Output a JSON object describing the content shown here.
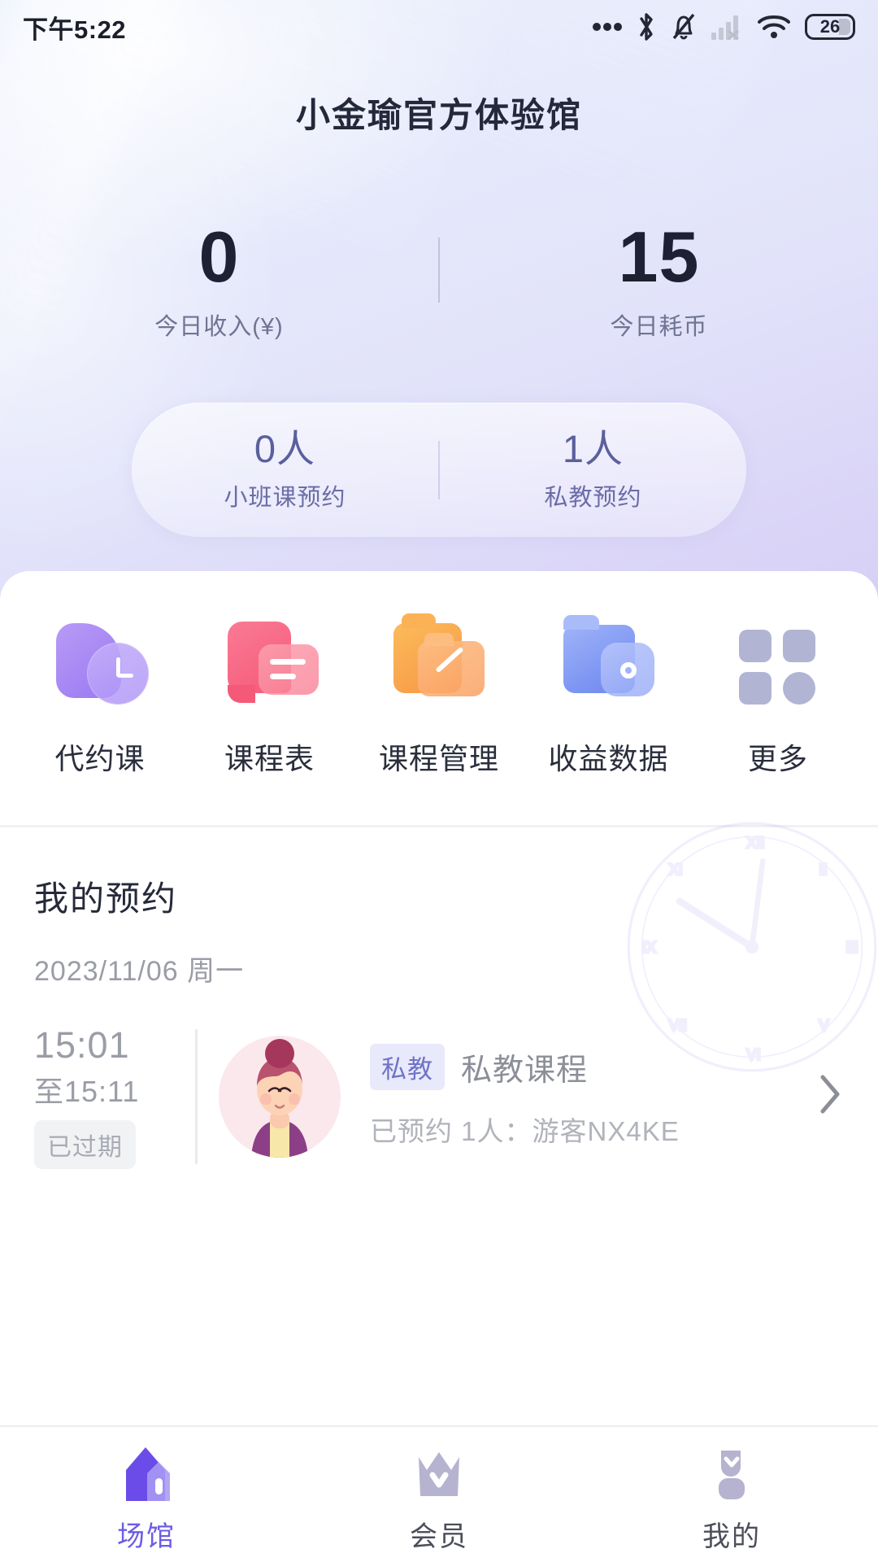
{
  "status_bar": {
    "time": "下午5:22",
    "battery_level": "26",
    "icons": [
      "more-dots-icon",
      "bluetooth-icon",
      "bell-muted-icon",
      "signal-off-icon",
      "wifi-icon",
      "battery-icon"
    ]
  },
  "header": {
    "title": "小金瑜官方体验馆"
  },
  "stats": [
    {
      "value": "0",
      "label": "今日收入(¥)"
    },
    {
      "value": "15",
      "label": "今日耗币"
    }
  ],
  "booking_pill": [
    {
      "value": "0人",
      "label": "小班课预约"
    },
    {
      "value": "1人",
      "label": "私教预约"
    }
  ],
  "shortcuts": [
    {
      "label": "代约课",
      "icon": "clock-booking-icon"
    },
    {
      "label": "课程表",
      "icon": "schedule-bubble-icon"
    },
    {
      "label": "课程管理",
      "icon": "folder-pen-icon"
    },
    {
      "label": "收益数据",
      "icon": "folder-chart-icon"
    },
    {
      "label": "更多",
      "icon": "grid-more-icon"
    }
  ],
  "my_bookings": {
    "title": "我的预约",
    "date": "2023/11/06 周一",
    "rows": [
      {
        "start_time": "15:01",
        "end_time": "至15:11",
        "status_badge": "已过期",
        "tag": "私教",
        "course_name": "私教课程",
        "detail": "已预约 1人：游客NX4KE",
        "avatar": "female-yoga-avatar",
        "chevron": "chevron-right-icon"
      }
    ]
  },
  "tab_bar": [
    {
      "label": "场馆",
      "icon": "home-venue-icon",
      "active": true
    },
    {
      "label": "会员",
      "icon": "crown-member-icon",
      "active": false
    },
    {
      "label": "我的",
      "icon": "person-profile-icon",
      "active": false
    }
  ],
  "colors": {
    "accent_purple": "#6b5ce7",
    "title_dark": "#23283a",
    "muted_gray": "#9a9da6",
    "pill_text": "#5b5f9c",
    "tag_bg": "#e8e9fb",
    "tag_text": "#6f73c4"
  }
}
